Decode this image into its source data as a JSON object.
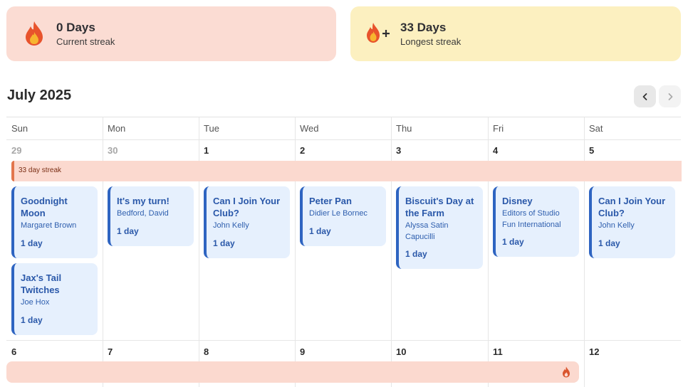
{
  "stats": {
    "current": {
      "value": "0 Days",
      "label": "Current streak",
      "icon": "flame-icon"
    },
    "longest": {
      "value": "33 Days",
      "label": "Longest streak",
      "icon": "flame-plus-icon"
    }
  },
  "calendar": {
    "month_title": "July 2025",
    "nav": {
      "prev_icon": "chevron-left-icon",
      "next_icon": "chevron-right-icon"
    },
    "weekdays": [
      "Sun",
      "Mon",
      "Tue",
      "Wed",
      "Thu",
      "Fri",
      "Sat"
    ],
    "week1": [
      "29",
      "30",
      "1",
      "2",
      "3",
      "4",
      "5"
    ],
    "week2": [
      "6",
      "7",
      "8",
      "9",
      "10",
      "11",
      "12"
    ],
    "streak_label": "33 day streak",
    "books": [
      {
        "title": "Goodnight Moon",
        "author": "Margaret Brown",
        "days": "1 day"
      },
      {
        "title": "Jax's Tail Twitches",
        "author": "Joe Hox",
        "days": "1 day"
      },
      {
        "title": "It's my turn!",
        "author": "Bedford, David",
        "days": "1 day"
      },
      {
        "title": "Can I Join Your Club?",
        "author": "John Kelly",
        "days": "1 day"
      },
      {
        "title": "Peter Pan",
        "author": "Didier Le Bornec",
        "days": "1 day"
      },
      {
        "title": "Biscuit's Day at the Farm",
        "author": "Alyssa Satin Capucilli",
        "days": "1 day"
      },
      {
        "title": "Disney",
        "author": "Editors of Studio Fun International",
        "days": "1 day"
      },
      {
        "title": "Can I Join Your Club?",
        "author": "John Kelly",
        "days": "1 day"
      }
    ]
  },
  "colors": {
    "current_card": "#fbdcd3",
    "longest_card": "#fcf0c0",
    "streak_bar": "#fbd9cf",
    "book_card": "#e6f0fd",
    "book_accent": "#2e64c1"
  }
}
